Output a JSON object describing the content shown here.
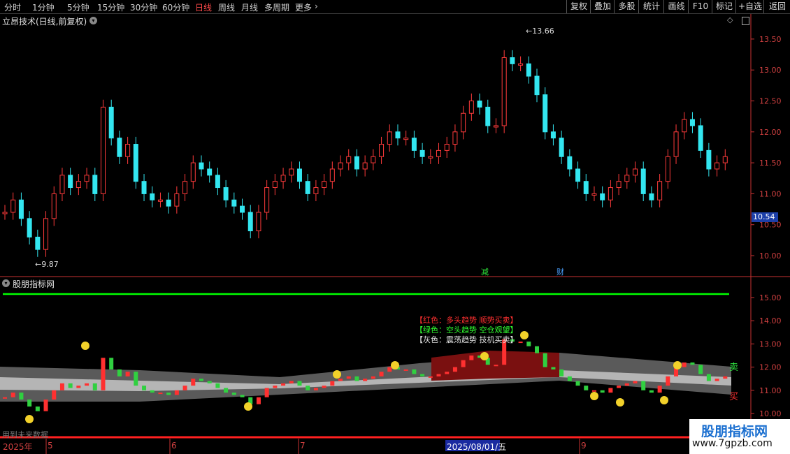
{
  "toolbar": {
    "timeframes": [
      "分时",
      "1分钟",
      "5分钟",
      "15分钟",
      "30分钟",
      "60分钟",
      "日线",
      "周线",
      "月线",
      "多周期",
      "更多"
    ],
    "active_timeframe": "日线",
    "right_buttons": [
      "复权",
      "叠加",
      "多股",
      "统计",
      "画线",
      "F10",
      "标记",
      "+自选",
      "返回"
    ]
  },
  "main_panel": {
    "title": "立昂技术(日线,前复权)",
    "high_marker": "13.66",
    "low_marker": "9.87",
    "current_price": "10.54",
    "event_marks": [
      "减",
      "财"
    ],
    "y_ticks": [
      "13.50",
      "13.00",
      "12.50",
      "12.00",
      "11.50",
      "11.00",
      "10.50",
      "10.00"
    ]
  },
  "indicator_panel": {
    "title": "股朋指标网",
    "legend": [
      {
        "text": "【红色：多头趋势 顺势买卖】",
        "color": "#ff3030"
      },
      {
        "text": "【绿色：空头趋势 空仓观望】",
        "color": "#30ff30"
      },
      {
        "text": "【灰色：震荡趋势 技机买卖】",
        "color": "#e0e0e0"
      }
    ],
    "sell_label": "卖",
    "buy_label": "买",
    "y_ticks": [
      "15.00",
      "14.00",
      "13.00",
      "12.00",
      "11.00",
      "10.00"
    ],
    "footer_note": "用到未来数据"
  },
  "date_axis": {
    "year_label": "2025年",
    "months": [
      "5",
      "6",
      "7",
      "8",
      "9"
    ],
    "cursor_date": "2025/08/01/五"
  },
  "watermark": {
    "title": "股朋指标网",
    "url": "www.7gpzb.com"
  },
  "colors": {
    "up": "#ff3b3b",
    "down": "#33e6f0",
    "axis": "#c83232",
    "signal_line": "#00ff00"
  },
  "icons": [
    "chevron-down-icon",
    "diamond-icon",
    "scroll-box-icon",
    "face-icon"
  ]
}
